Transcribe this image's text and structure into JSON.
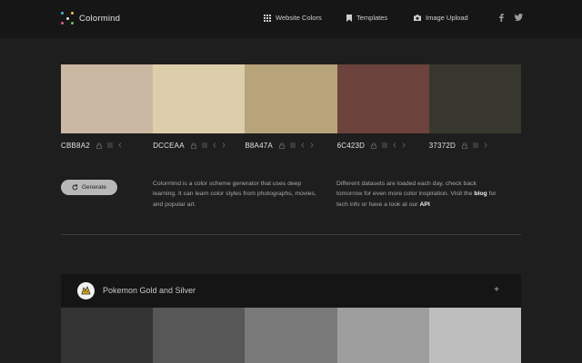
{
  "brand": {
    "name": "Colormind"
  },
  "nav": {
    "website_colors": "Website Colors",
    "templates": "Templates",
    "image_upload": "Image Upload"
  },
  "palette": [
    {
      "hex": "CBB8A2",
      "color": "#CBB8A2"
    },
    {
      "hex": "DCCEAA",
      "color": "#DCCEAA"
    },
    {
      "hex": "B8A47A",
      "color": "#B8A47A"
    },
    {
      "hex": "6C423D",
      "color": "#6C423D"
    },
    {
      "hex": "37372D",
      "color": "#37372D"
    }
  ],
  "generate_label": "Generate",
  "desc_left": "Colormind is a color scheme generator that uses deep learning. It can learn color styles from photographs, movies, and popular art.",
  "desc_right": {
    "text1": "Different datasets are loaded each day, check back tomorrow for even more color inspiration. Visit the ",
    "blog": "blog",
    "text2": " for tech info or have a look at our ",
    "api": "API"
  },
  "template_card": {
    "title": "Pokemon Gold and Silver",
    "expand": "+",
    "swatches": [
      "#333333",
      "#575757",
      "#7a7a7a",
      "#9e9e9e",
      "#bebebe"
    ]
  },
  "colors": {
    "background": "#1e1e1e",
    "nav": "#161616",
    "card": "#151515",
    "button": "#b8b8b8"
  }
}
